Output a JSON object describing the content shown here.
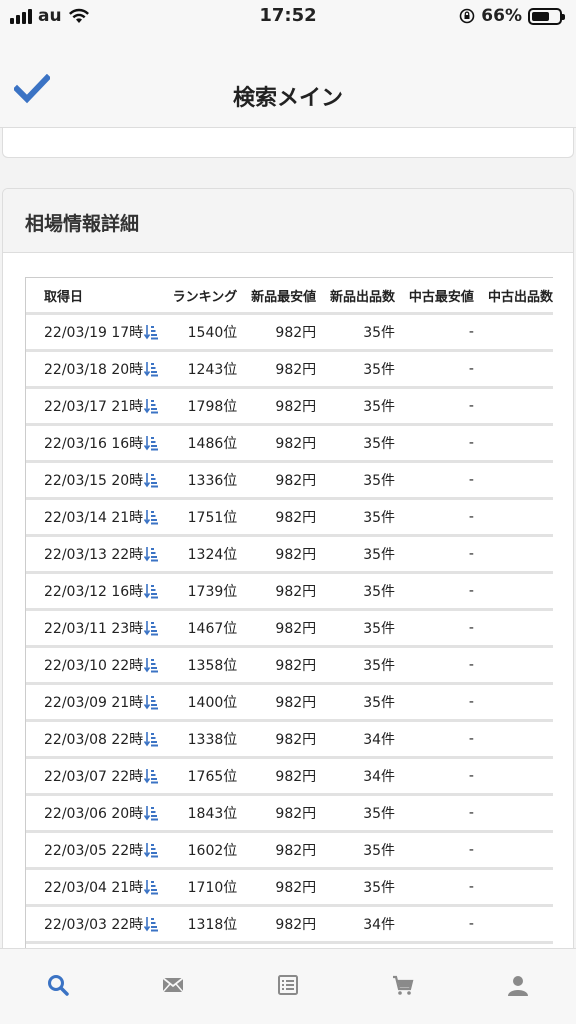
{
  "status_bar": {
    "carrier": "au",
    "time": "17:52",
    "battery_pct": "66%",
    "battery_level": 0.66
  },
  "nav": {
    "title": "検索メイン",
    "check_icon": "checkmark-icon",
    "accent_color": "#3b73c4"
  },
  "panel": {
    "title": "相場情報詳細"
  },
  "table": {
    "columns": [
      "取得日",
      "ランキング",
      "新品最安値",
      "新品出品数",
      "中古最安値",
      "中古出品数"
    ],
    "rows": [
      {
        "date": "22/03/19 17時",
        "rank": "1540位",
        "new_price": "982円",
        "new_count": "35件",
        "used_price": "-"
      },
      {
        "date": "22/03/18 20時",
        "rank": "1243位",
        "new_price": "982円",
        "new_count": "35件",
        "used_price": "-"
      },
      {
        "date": "22/03/17 21時",
        "rank": "1798位",
        "new_price": "982円",
        "new_count": "35件",
        "used_price": "-"
      },
      {
        "date": "22/03/16 16時",
        "rank": "1486位",
        "new_price": "982円",
        "new_count": "35件",
        "used_price": "-"
      },
      {
        "date": "22/03/15 20時",
        "rank": "1336位",
        "new_price": "982円",
        "new_count": "35件",
        "used_price": "-"
      },
      {
        "date": "22/03/14 21時",
        "rank": "1751位",
        "new_price": "982円",
        "new_count": "35件",
        "used_price": "-"
      },
      {
        "date": "22/03/13 22時",
        "rank": "1324位",
        "new_price": "982円",
        "new_count": "35件",
        "used_price": "-"
      },
      {
        "date": "22/03/12 16時",
        "rank": "1739位",
        "new_price": "982円",
        "new_count": "35件",
        "used_price": "-"
      },
      {
        "date": "22/03/11 23時",
        "rank": "1467位",
        "new_price": "982円",
        "new_count": "35件",
        "used_price": "-"
      },
      {
        "date": "22/03/10 22時",
        "rank": "1358位",
        "new_price": "982円",
        "new_count": "35件",
        "used_price": "-"
      },
      {
        "date": "22/03/09 21時",
        "rank": "1400位",
        "new_price": "982円",
        "new_count": "35件",
        "used_price": "-"
      },
      {
        "date": "22/03/08 22時",
        "rank": "1338位",
        "new_price": "982円",
        "new_count": "34件",
        "used_price": "-"
      },
      {
        "date": "22/03/07 22時",
        "rank": "1765位",
        "new_price": "982円",
        "new_count": "34件",
        "used_price": "-"
      },
      {
        "date": "22/03/06 20時",
        "rank": "1843位",
        "new_price": "982円",
        "new_count": "35件",
        "used_price": "-"
      },
      {
        "date": "22/03/05 22時",
        "rank": "1602位",
        "new_price": "982円",
        "new_count": "35件",
        "used_price": "-"
      },
      {
        "date": "22/03/04 21時",
        "rank": "1710位",
        "new_price": "982円",
        "new_count": "35件",
        "used_price": "-"
      },
      {
        "date": "22/03/03 22時",
        "rank": "1318位",
        "new_price": "982円",
        "new_count": "34件",
        "used_price": "-"
      }
    ],
    "sort_icon": "sort-amount-down-icon",
    "icon_color": "#3b73c4"
  },
  "tab_bar": {
    "tabs": [
      {
        "icon": "search-icon",
        "active": true
      },
      {
        "icon": "mail-icon",
        "active": false
      },
      {
        "icon": "list-icon",
        "active": false
      },
      {
        "icon": "cart-icon",
        "active": false
      },
      {
        "icon": "user-icon",
        "active": false
      }
    ],
    "active_color": "#3b73c4",
    "inactive_color": "#8a8a8a"
  }
}
